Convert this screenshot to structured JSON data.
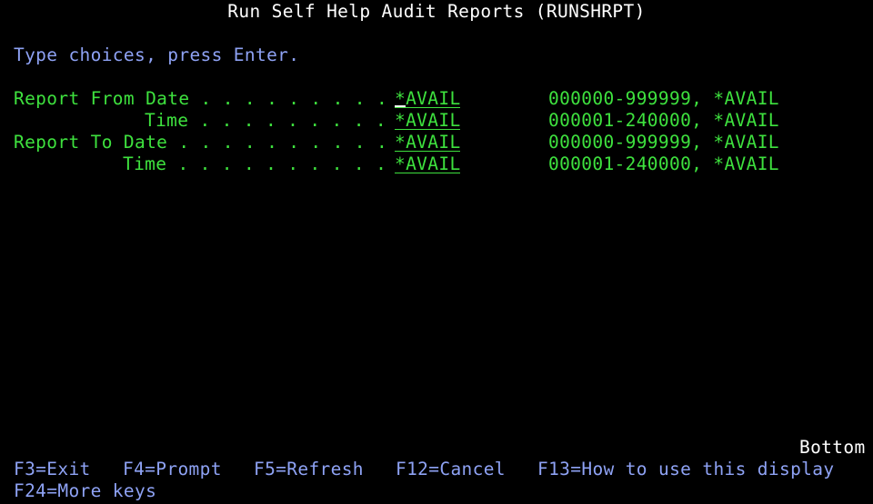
{
  "screen": {
    "title": "Run Self Help Audit Reports (RUNSHRPT)",
    "instruction": "Type choices, press Enter.",
    "colors": {
      "background": "#000000",
      "title": "#ffffff",
      "instruction": "#8ea2f4",
      "field": "#3ee13e",
      "function_key": "#8ea2f4"
    }
  },
  "prompts": [
    {
      "label": "Report From Date . . . . . . . . .",
      "value": "*AVAIL",
      "allowed": "000000-999999, *AVAIL"
    },
    {
      "label": "Time . . . . . . . . .",
      "value": "*AVAIL",
      "allowed": "000001-240000, *AVAIL"
    },
    {
      "label": "Report To Date . . . . . . . . . .",
      "value": "*AVAIL",
      "allowed": "000000-999999, *AVAIL"
    },
    {
      "label": "Time . . . . . . . . . .",
      "value": "*AVAIL",
      "allowed": "000001-240000, *AVAIL"
    }
  ],
  "status": {
    "scroll_indicator": "Bottom"
  },
  "function_keys": [
    {
      "label": "F3=Exit"
    },
    {
      "label": "F4=Prompt"
    },
    {
      "label": "F5=Refresh"
    },
    {
      "label": "F12=Cancel"
    },
    {
      "label": "F13=How to use this display"
    },
    {
      "label": "F24=More keys"
    }
  ]
}
